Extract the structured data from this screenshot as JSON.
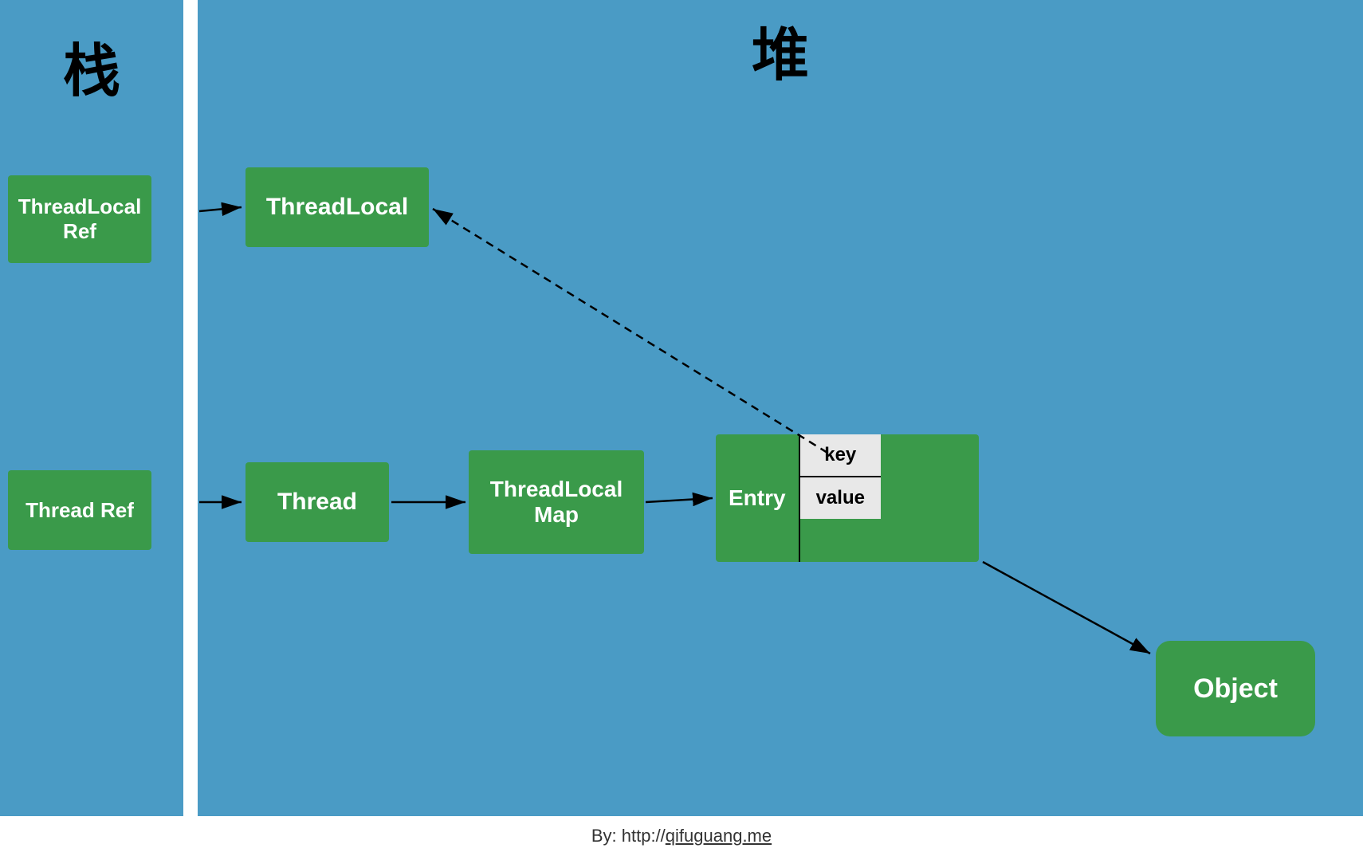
{
  "diagram": {
    "stack_title": "栈",
    "heap_title": "堆",
    "boxes": {
      "thread_local_ref": "ThreadLocal Ref",
      "thread_ref": "Thread Ref",
      "thread_local": "ThreadLocal",
      "thread": "Thread",
      "thread_local_map": "ThreadLocal Map",
      "entry_label": "Entry",
      "entry_key": "key",
      "entry_value": "value",
      "object": "Object"
    },
    "footer_text": "By: http://qifuguang.me"
  }
}
